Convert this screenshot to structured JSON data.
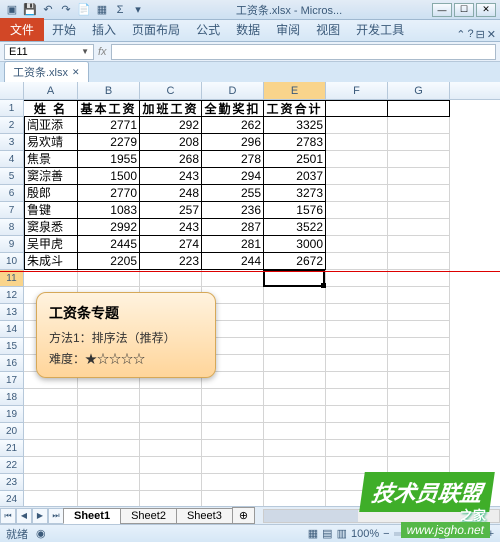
{
  "window": {
    "title": "工资条.xlsx - Micros..."
  },
  "ribbon": {
    "file": "文件",
    "tabs": [
      "开始",
      "插入",
      "页面布局",
      "公式",
      "数据",
      "审阅",
      "视图",
      "开发工具"
    ]
  },
  "namebox": "E11",
  "fx_label": "fx",
  "workbook_tab": "工资条.xlsx",
  "columns": [
    "A",
    "B",
    "C",
    "D",
    "E",
    "F",
    "G"
  ],
  "headers": [
    "姓 名",
    "基本工资",
    "加班工资",
    "全勤奖扣",
    "工资合计"
  ],
  "data_rows": [
    {
      "name": "訚亚添",
      "base": 2771,
      "ot": 292,
      "bonus": 262,
      "total": 3325
    },
    {
      "name": "易欢靖",
      "base": 2279,
      "ot": 208,
      "bonus": 296,
      "total": 2783
    },
    {
      "name": "焦景",
      "base": 1955,
      "ot": 268,
      "bonus": 278,
      "total": 2501
    },
    {
      "name": "窦淙善",
      "base": 1500,
      "ot": 243,
      "bonus": 294,
      "total": 2037
    },
    {
      "name": "殷郎",
      "base": 2770,
      "ot": 248,
      "bonus": 255,
      "total": 3273
    },
    {
      "name": "鲁键",
      "base": 1083,
      "ot": 257,
      "bonus": 236,
      "total": 1576
    },
    {
      "name": "窦泉悉",
      "base": 2992,
      "ot": 243,
      "bonus": 287,
      "total": 3522
    },
    {
      "name": "吴甲虎",
      "base": 2445,
      "ot": 274,
      "bonus": 281,
      "total": 3000
    },
    {
      "name": "朱成斗",
      "base": 2205,
      "ot": 223,
      "bonus": 244,
      "total": 2672
    }
  ],
  "empty_row_start": 11,
  "empty_row_end": 25,
  "active_cell": "E11",
  "callout": {
    "title": "工资条专题",
    "method": "方法1：排序法（推荐）",
    "difficulty": "难度：★☆☆☆☆"
  },
  "sheets": [
    "Sheet1",
    "Sheet2",
    "Sheet3"
  ],
  "active_sheet": "Sheet1",
  "status": {
    "ready": "就绪",
    "zoom": "100%",
    "plus": "+",
    "minus": "−"
  },
  "watermarks": {
    "w1": "技术员联盟",
    "w2": "之家",
    "w3": "www.jsgho.net"
  }
}
